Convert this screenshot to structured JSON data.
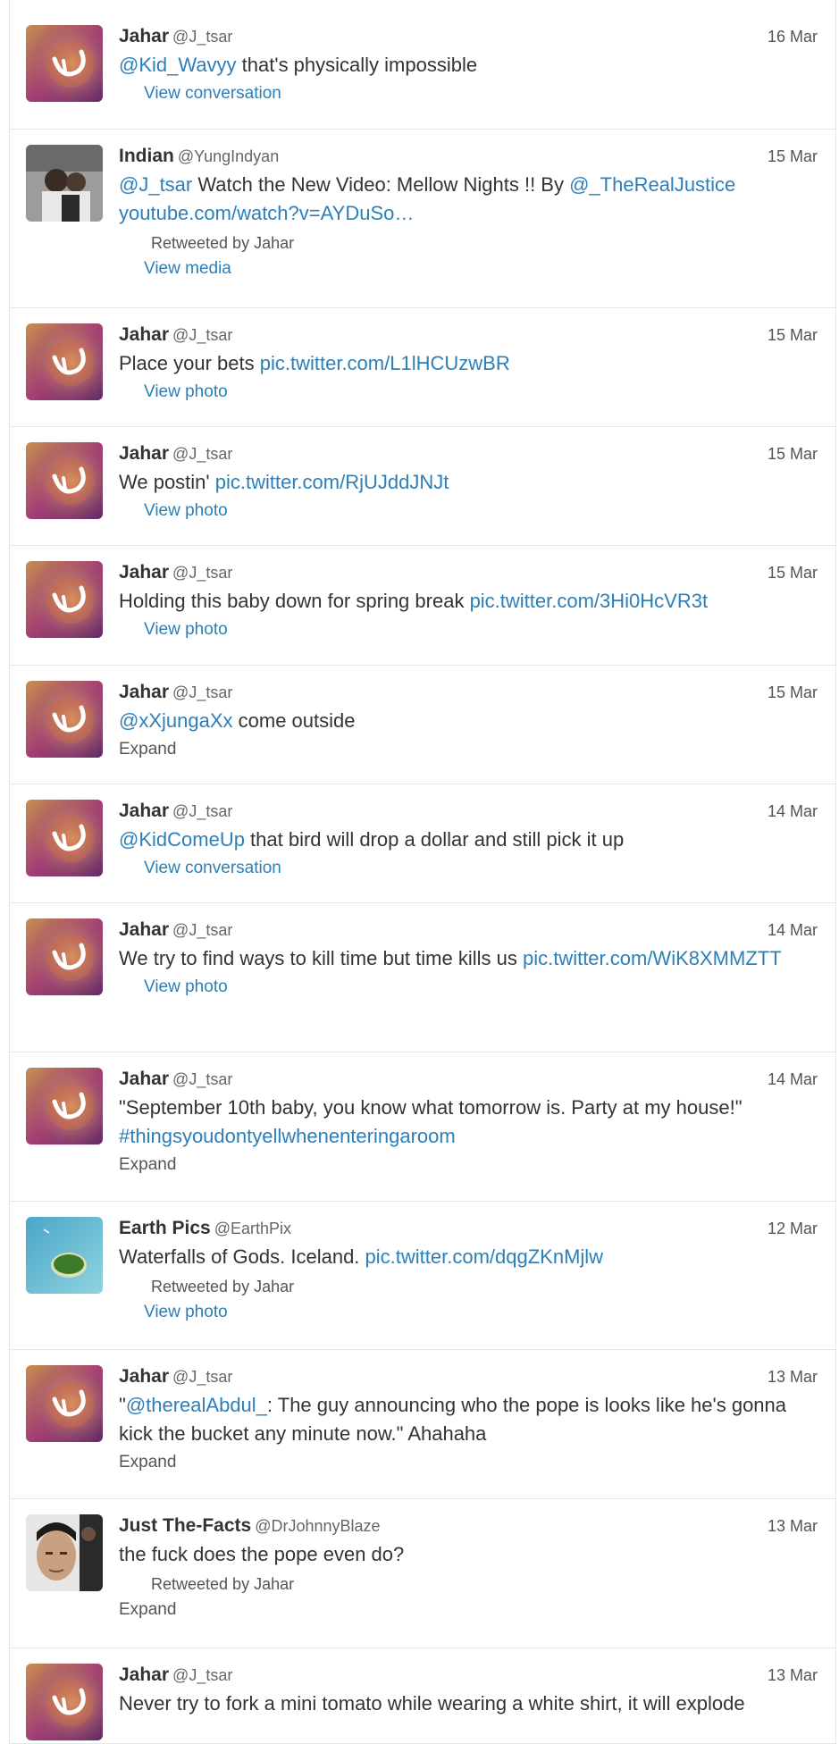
{
  "colors": {
    "link": "#2c7fb8",
    "border": "#e1e8ed",
    "text": "#333333",
    "muted": "#666666"
  },
  "tweets": [
    {
      "name": "Jahar",
      "handle": "@J_tsar",
      "date": "16 Mar",
      "avatar": "lion-avatar",
      "parts": [
        {
          "t": "@Kid_Wavyy",
          "link": true
        },
        {
          "t": " that's physically impossible",
          "link": false
        }
      ],
      "retweeted_by": "",
      "action": "View conversation",
      "action_type": "link"
    },
    {
      "name": "Indian",
      "handle": "@YungIndyan",
      "date": "15 Mar",
      "avatar": "photo-avatar",
      "parts": [
        {
          "t": "@J_tsar",
          "link": true
        },
        {
          "t": " Watch the New Video: Mellow Nights !! By ",
          "link": false
        },
        {
          "t": "@_TheRealJustice youtube.com/watch?v=AYDuSo",
          "link": true
        },
        {
          "t": "…",
          "link": true
        }
      ],
      "retweeted_by": "Retweeted by Jahar",
      "action": "View media",
      "action_type": "link"
    },
    {
      "name": "Jahar",
      "handle": "@J_tsar",
      "date": "15 Mar",
      "avatar": "lion-avatar",
      "parts": [
        {
          "t": "Place your bets ",
          "link": false
        },
        {
          "t": "pic.twitter.com/L1lHCUzwBR",
          "link": true
        }
      ],
      "retweeted_by": "",
      "action": "View photo",
      "action_type": "link"
    },
    {
      "name": "Jahar",
      "handle": "@J_tsar",
      "date": "15 Mar",
      "avatar": "lion-avatar",
      "parts": [
        {
          "t": "We postin' ",
          "link": false
        },
        {
          "t": "pic.twitter.com/RjUJddJNJt",
          "link": true
        }
      ],
      "retweeted_by": "",
      "action": "View photo",
      "action_type": "link"
    },
    {
      "name": "Jahar",
      "handle": "@J_tsar",
      "date": "15 Mar",
      "avatar": "lion-avatar",
      "parts": [
        {
          "t": "Holding this baby down for spring break ",
          "link": false
        },
        {
          "t": "pic.twitter.com/3Hi0HcVR3t",
          "link": true
        }
      ],
      "retweeted_by": "",
      "action": "View photo",
      "action_type": "link"
    },
    {
      "name": "Jahar",
      "handle": "@J_tsar",
      "date": "15 Mar",
      "avatar": "lion-avatar",
      "parts": [
        {
          "t": "@xXjungaXx",
          "link": true
        },
        {
          "t": " come outside",
          "link": false
        }
      ],
      "retweeted_by": "",
      "action": "Expand",
      "action_type": "expand"
    },
    {
      "name": "Jahar",
      "handle": "@J_tsar",
      "date": "14 Mar",
      "avatar": "lion-avatar",
      "parts": [
        {
          "t": "@KidComeUp",
          "link": true
        },
        {
          "t": " that bird will drop a dollar and still pick it up",
          "link": false
        }
      ],
      "retweeted_by": "",
      "action": "View conversation",
      "action_type": "link"
    },
    {
      "name": "Jahar",
      "handle": "@J_tsar",
      "date": "14 Mar",
      "avatar": "lion-avatar",
      "parts": [
        {
          "t": "We try to find ways to kill time but time kills us ",
          "link": false
        },
        {
          "t": "pic.twitter.com/WiK8XMMZTT",
          "link": true
        }
      ],
      "retweeted_by": "",
      "action": "View photo",
      "action_type": "link"
    },
    {
      "name": "Jahar",
      "handle": "@J_tsar",
      "date": "14 Mar",
      "avatar": "lion-avatar",
      "parts": [
        {
          "t": "\"September 10th baby, you know what tomorrow is. Party at my house!\" ",
          "link": false
        },
        {
          "t": "#thingsyoudontyellwhenenteringaroom",
          "link": true
        }
      ],
      "retweeted_by": "",
      "action": "Expand",
      "action_type": "expand"
    },
    {
      "name": "Earth Pics",
      "handle": "@EarthPix",
      "date": "12 Mar",
      "avatar": "island-avatar",
      "parts": [
        {
          "t": "Waterfalls of Gods. Iceland. ",
          "link": false
        },
        {
          "t": "pic.twitter.com/dqgZKnMjlw",
          "link": true
        }
      ],
      "retweeted_by": "Retweeted by Jahar",
      "action": "View photo",
      "action_type": "link"
    },
    {
      "name": "Jahar",
      "handle": "@J_tsar",
      "date": "13 Mar",
      "avatar": "lion-avatar",
      "parts": [
        {
          "t": "\"",
          "link": false
        },
        {
          "t": "@therealAbdul_",
          "link": true
        },
        {
          "t": ": The guy announcing who the pope is looks like he's gonna kick the bucket any minute now.\" Ahahaha",
          "link": false
        }
      ],
      "retweeted_by": "",
      "action": "Expand",
      "action_type": "expand"
    },
    {
      "name": "Just The-Facts",
      "handle": "@DrJohnnyBlaze",
      "date": "13 Mar",
      "avatar": "face-avatar",
      "parts": [
        {
          "t": "the fuck does the pope even do?",
          "link": false
        }
      ],
      "retweeted_by": "Retweeted by Jahar",
      "action": "Expand",
      "action_type": "expand"
    },
    {
      "name": "Jahar",
      "handle": "@J_tsar",
      "date": "13 Mar",
      "avatar": "lion-avatar",
      "parts": [
        {
          "t": "Never try to fork a mini tomato while wearing a white shirt, it will explode",
          "link": false
        }
      ],
      "retweeted_by": "",
      "action": "",
      "action_type": "none"
    }
  ]
}
